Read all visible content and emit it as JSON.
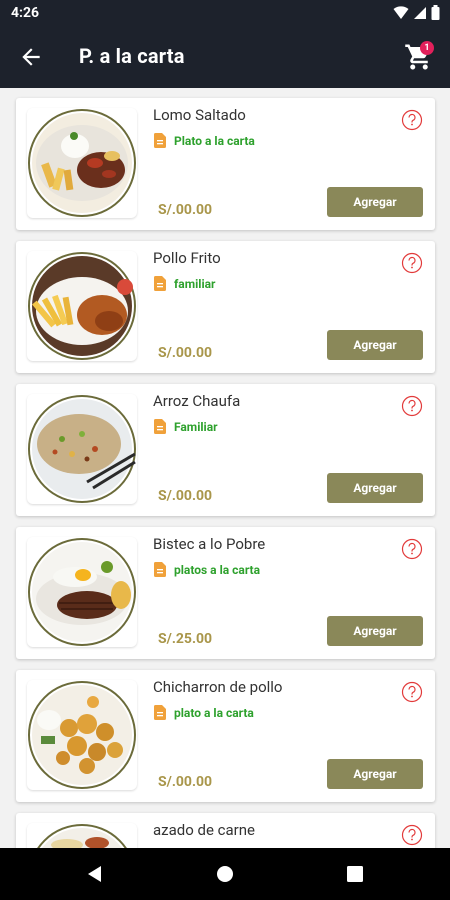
{
  "status": {
    "time": "4:26",
    "icons": [
      "wifi-icon",
      "signal-icon",
      "battery-icon"
    ]
  },
  "appbar": {
    "title": "P. a la carta",
    "cart_badge": "1"
  },
  "items": [
    {
      "name": "Lomo Saltado",
      "category": "Plato a la carta",
      "price": "S/.00.00",
      "button": "Agregar"
    },
    {
      "name": "Pollo Frito",
      "category": "familiar",
      "price": "S/.00.00",
      "button": "Agregar"
    },
    {
      "name": "Arroz Chaufa",
      "category": "Familiar",
      "price": "S/.00.00",
      "button": "Agregar"
    },
    {
      "name": "Bistec a lo Pobre",
      "category": "platos a la carta",
      "price": "S/.25.00",
      "button": "Agregar"
    },
    {
      "name": "Chicharron de pollo",
      "category": "plato a la carta",
      "price": "S/.00.00",
      "button": "Agregar"
    },
    {
      "name": "azado de carne",
      "category": "",
      "price": "",
      "button": ""
    }
  ],
  "colors": {
    "appbar": "#1d222c",
    "button": "#8a8859",
    "price": "#a9964a",
    "category": "#2ea12d",
    "badge": "#e2205b",
    "help": "#e23a3a",
    "doc_icon": "#f0a13a"
  },
  "navbar": {
    "icons": [
      "back-triangle-icon",
      "home-circle-icon",
      "recents-square-icon"
    ]
  }
}
